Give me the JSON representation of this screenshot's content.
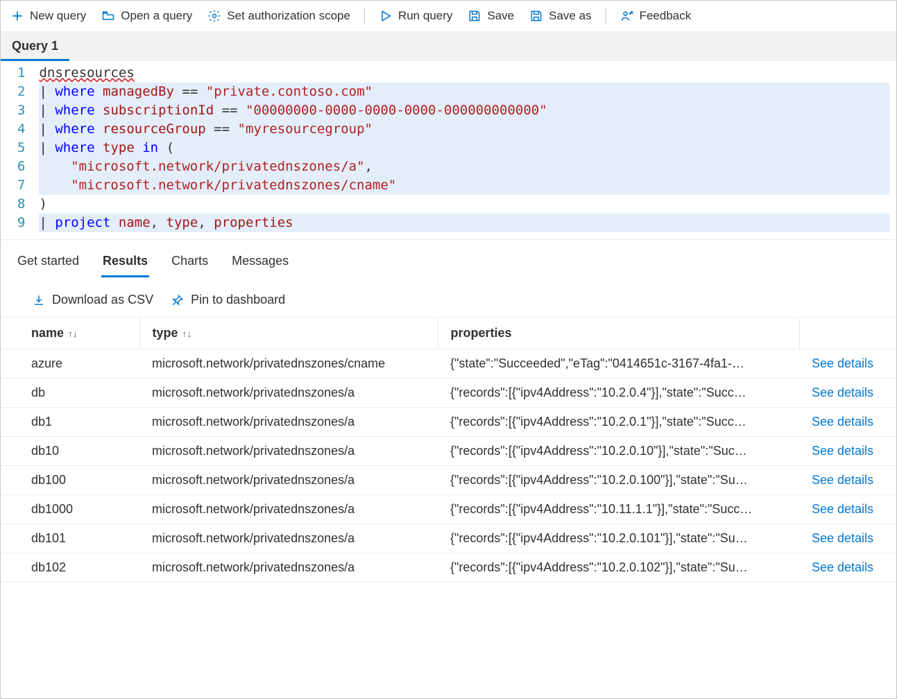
{
  "toolbar": {
    "new_query": "New query",
    "open_query": "Open a query",
    "auth_scope": "Set authorization scope",
    "run_query": "Run query",
    "save": "Save",
    "save_as": "Save as",
    "feedback": "Feedback"
  },
  "query_tab": "Query 1",
  "editor": {
    "lines": [
      "dnsresources",
      "| where managedBy == \"private.contoso.com\"",
      "| where subscriptionId == \"00000000-0000-0000-0000-000000000000\"",
      "| where resourceGroup == \"myresourcegroup\"",
      "| where type in (",
      "    \"microsoft.network/privatednszones/a\",",
      "    \"microsoft.network/privatednszones/cname\"",
      ")",
      "| project name, type, properties"
    ],
    "str_managedBy": "\"private.contoso.com\"",
    "str_subscription": "\"00000000-0000-0000-0000-000000000000\"",
    "str_rg": "\"myresourcegroup\"",
    "str_typeA": "\"microsoft.network/privatednszones/a\"",
    "str_typeCname": "\"microsoft.network/privatednszones/cname\""
  },
  "result_tabs": {
    "get_started": "Get started",
    "results": "Results",
    "charts": "Charts",
    "messages": "Messages"
  },
  "result_actions": {
    "download_csv": "Download as CSV",
    "pin": "Pin to dashboard"
  },
  "columns": {
    "name": "name",
    "type": "type",
    "properties": "properties"
  },
  "see_details": "See details",
  "rows": [
    {
      "name": "azure",
      "type": "microsoft.network/privatednszones/cname",
      "properties": "{\"state\":\"Succeeded\",\"eTag\":\"0414651c-3167-4fa1-…"
    },
    {
      "name": "db",
      "type": "microsoft.network/privatednszones/a",
      "properties": "{\"records\":[{\"ipv4Address\":\"10.2.0.4\"}],\"state\":\"Succ…"
    },
    {
      "name": "db1",
      "type": "microsoft.network/privatednszones/a",
      "properties": "{\"records\":[{\"ipv4Address\":\"10.2.0.1\"}],\"state\":\"Succ…"
    },
    {
      "name": "db10",
      "type": "microsoft.network/privatednszones/a",
      "properties": "{\"records\":[{\"ipv4Address\":\"10.2.0.10\"}],\"state\":\"Suc…"
    },
    {
      "name": "db100",
      "type": "microsoft.network/privatednszones/a",
      "properties": "{\"records\":[{\"ipv4Address\":\"10.2.0.100\"}],\"state\":\"Su…"
    },
    {
      "name": "db1000",
      "type": "microsoft.network/privatednszones/a",
      "properties": "{\"records\":[{\"ipv4Address\":\"10.11.1.1\"}],\"state\":\"Succ…"
    },
    {
      "name": "db101",
      "type": "microsoft.network/privatednszones/a",
      "properties": "{\"records\":[{\"ipv4Address\":\"10.2.0.101\"}],\"state\":\"Su…"
    },
    {
      "name": "db102",
      "type": "microsoft.network/privatednszones/a",
      "properties": "{\"records\":[{\"ipv4Address\":\"10.2.0.102\"}],\"state\":\"Su…"
    }
  ]
}
